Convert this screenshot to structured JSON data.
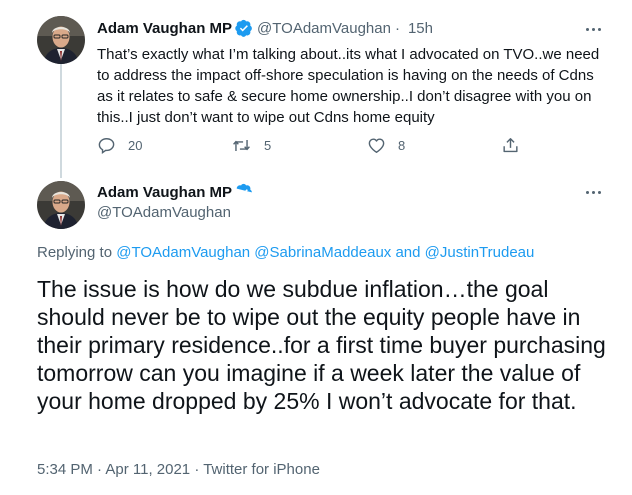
{
  "tweets": [
    {
      "author_name": "Adam Vaughan MP",
      "handle": "@TOAdamVaughan",
      "separator": "·",
      "time": "15h",
      "text": "That’s exactly what I’m talking about..its what I advocated on TVO..we need to address the impact off-shore speculation is having on the needs of Cdns as it relates to safe & secure home ownership..I don’t disagree with you on this..I just don’t want to wipe out Cdns home equity",
      "reply_count": "20",
      "retweet_count": "5",
      "like_count": "8"
    },
    {
      "author_name": "Adam Vaughan MP",
      "handle": "@TOAdamVaughan",
      "replying_prefix": "Replying to",
      "replying_mentions": "@TOAdamVaughan @SabrinaMaddeaux and @JustinTrudeau",
      "text": "The issue is how do we subdue inflation…the goal should never be to wipe out the equity people have in their primary residence..for a first time buyer purchasing tomorrow can you imagine if a week later the value of your home dropped by 25%  I won’t advocate for that.",
      "timestamp": "5:34 PM · Apr 11, 2021 · Twitter for iPhone"
    }
  ],
  "icons": {
    "verified": "verified-badge-icon",
    "more": "more-options-icon",
    "reply": "reply-icon",
    "retweet": "retweet-icon",
    "like": "like-icon",
    "share": "share-icon"
  },
  "colors": {
    "brand_blue": "#1d9bf0",
    "secondary_text": "#536471",
    "primary_text": "#0f1419",
    "thread_line": "#cfd9de"
  }
}
